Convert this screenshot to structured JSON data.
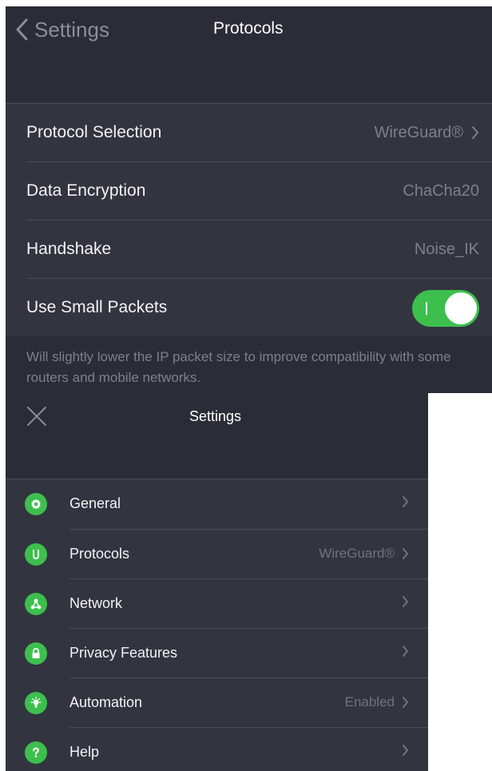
{
  "protocols_screen": {
    "back_label": "Settings",
    "title": "Protocols",
    "rows": [
      {
        "label": "Protocol Selection",
        "value": "WireGuard®",
        "has_chevron": true
      },
      {
        "label": "Data Encryption",
        "value": "ChaCha20",
        "has_chevron": false
      },
      {
        "label": "Handshake",
        "value": "Noise_IK",
        "has_chevron": false
      },
      {
        "label": "Use Small Packets",
        "toggle_on": true
      }
    ],
    "footnote": "Will slightly lower the IP packet size to improve compatibility with some routers and mobile networks."
  },
  "settings_screen": {
    "title": "Settings",
    "items": [
      {
        "label": "General",
        "value": "",
        "icon": "gear-icon"
      },
      {
        "label": "Protocols",
        "value": "WireGuard®",
        "icon": "protocols-icon"
      },
      {
        "label": "Network",
        "value": "",
        "icon": "network-icon"
      },
      {
        "label": "Privacy Features",
        "value": "",
        "icon": "lock-icon"
      },
      {
        "label": "Automation",
        "value": "Enabled",
        "icon": "lightbulb-icon"
      },
      {
        "label": "Help",
        "value": "",
        "icon": "help-icon"
      }
    ]
  },
  "colors": {
    "accent_green": "#3dbf4e",
    "panel_bg": "#32353f",
    "nav_bg": "#2a2d37",
    "secondary_text": "#7c808b"
  }
}
